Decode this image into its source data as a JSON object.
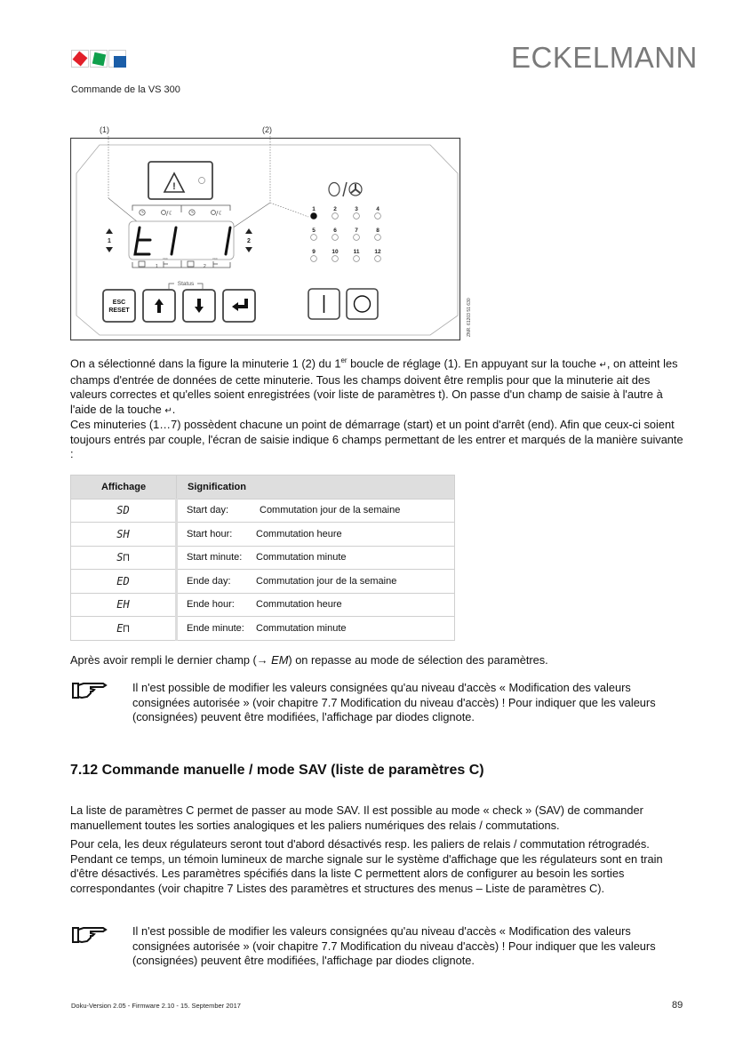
{
  "header": {
    "logo_colors": [
      "#e2202a",
      "#10a04c",
      "#1b5ea8"
    ],
    "brand": "ECKELMANN",
    "subtitle": "Commande de la VS 300"
  },
  "figure": {
    "callouts": [
      "(1)",
      "(2)"
    ],
    "display_chars": [
      "t",
      "1",
      "1"
    ],
    "side_labels": [
      "1",
      "2"
    ],
    "bottom_labels": [
      "1",
      "2"
    ],
    "off_label": "OFF",
    "status_label": "Status",
    "esc_button": [
      "ESC",
      "RESET"
    ],
    "relay_leds": [
      {
        "num": "1",
        "on": true
      },
      {
        "num": "2",
        "on": false
      },
      {
        "num": "3",
        "on": false
      },
      {
        "num": "4",
        "on": false
      },
      {
        "num": "5",
        "on": false
      },
      {
        "num": "6",
        "on": false
      },
      {
        "num": "7",
        "on": false
      },
      {
        "num": "8",
        "on": false
      },
      {
        "num": "9",
        "on": false
      },
      {
        "num": "10",
        "on": false
      },
      {
        "num": "11",
        "on": false
      },
      {
        "num": "12",
        "on": false
      }
    ],
    "side_code": "ZNR. 61203 51 630"
  },
  "paragraphs": {
    "p1_a": "On a sélectionné dans la figure la minuterie 1 (2) du 1",
    "p1_sup": "er",
    "p1_b": " boucle de réglage (1). En appuyant sur la touche ",
    "p1_c": ", on atteint les champs d'entrée de données de cette minuterie. Tous les champs doivent être remplis pour que la minuterie ait des valeurs correctes et qu'elles soient enregistrées (voir liste de paramètres t). On passe d'un champ de saisie à l'autre à l'aide de la touche ",
    "p1_d": ".",
    "return_glyph": "↵",
    "p2": "Ces minuteries (1…7) possèdent chacune un point de démarrage (start) et un point d'arrêt (end). Afin que ceux-ci soient toujours entrés par couple, l'écran de saisie indique 6 champs permettant de les entrer et marqués de la manière suivante :",
    "p3_a": "Après avoir rempli le dernier champ (→ ",
    "p3_em": "EM",
    "p3_b": ") on repasse au mode de sélection des paramètres."
  },
  "table": {
    "headers": [
      "Affichage",
      "Signification"
    ],
    "rows": [
      {
        "code": "SD",
        "label": "Start day:",
        "desc": "Commutation jour de la semaine"
      },
      {
        "code": "SH",
        "label": "Start hour:",
        "desc": "Commutation heure"
      },
      {
        "code": "S⊓",
        "label": "Start minute:",
        "desc": "Commutation minute"
      },
      {
        "code": "ED",
        "label": "Ende day:",
        "desc": "Commutation jour de la semaine"
      },
      {
        "code": "EH",
        "label": "Ende hour:",
        "desc": "Commutation heure"
      },
      {
        "code": "E⊓",
        "label": "Ende minute:",
        "desc": "Commutation minute"
      }
    ]
  },
  "note1": "Il n'est possible de modifier les valeurs consignées qu'au niveau d'accès « Modification des valeurs consignées autorisée » (voir chapitre 7.7 Modification du niveau d'accès) ! Pour indiquer que les valeurs (consignées) peuvent être modifiées, l'affichage par diodes clignote.",
  "section": {
    "title": "7.12 Commande manuelle / mode SAV  (liste de paramètres C)",
    "p1": "La liste de paramètres C permet de passer au mode SAV. Il est possible au mode « check » (SAV) de commander manuellement toutes les sorties analogiques et les paliers numériques des relais / commutations.",
    "p2": "Pour cela, les deux régulateurs seront tout d'abord désactivés resp. les paliers de relais / commutation rétrogradés. Pendant ce temps, un témoin lumineux de marche signale sur le système d'affichage que les régulateurs sont en train d'être désactivés. Les paramètres spécifiés dans la liste C permettent alors de configurer au besoin les sorties correspondantes (voir chapitre 7 Listes des paramètres et structures des menus – Liste de paramètres C)."
  },
  "note2": "Il n'est possible de modifier les valeurs consignées qu'au niveau d'accès « Modification des valeurs consignées autorisée » (voir chapitre 7.7 Modification du niveau d'accès) ! Pour indiquer que les valeurs (consignées) peuvent être modifiées, l'affichage par diodes clignote.",
  "footer": {
    "version": "Doku-Version 2.05 - Firmware 2.10 - 15. September 2017",
    "page": "89"
  }
}
